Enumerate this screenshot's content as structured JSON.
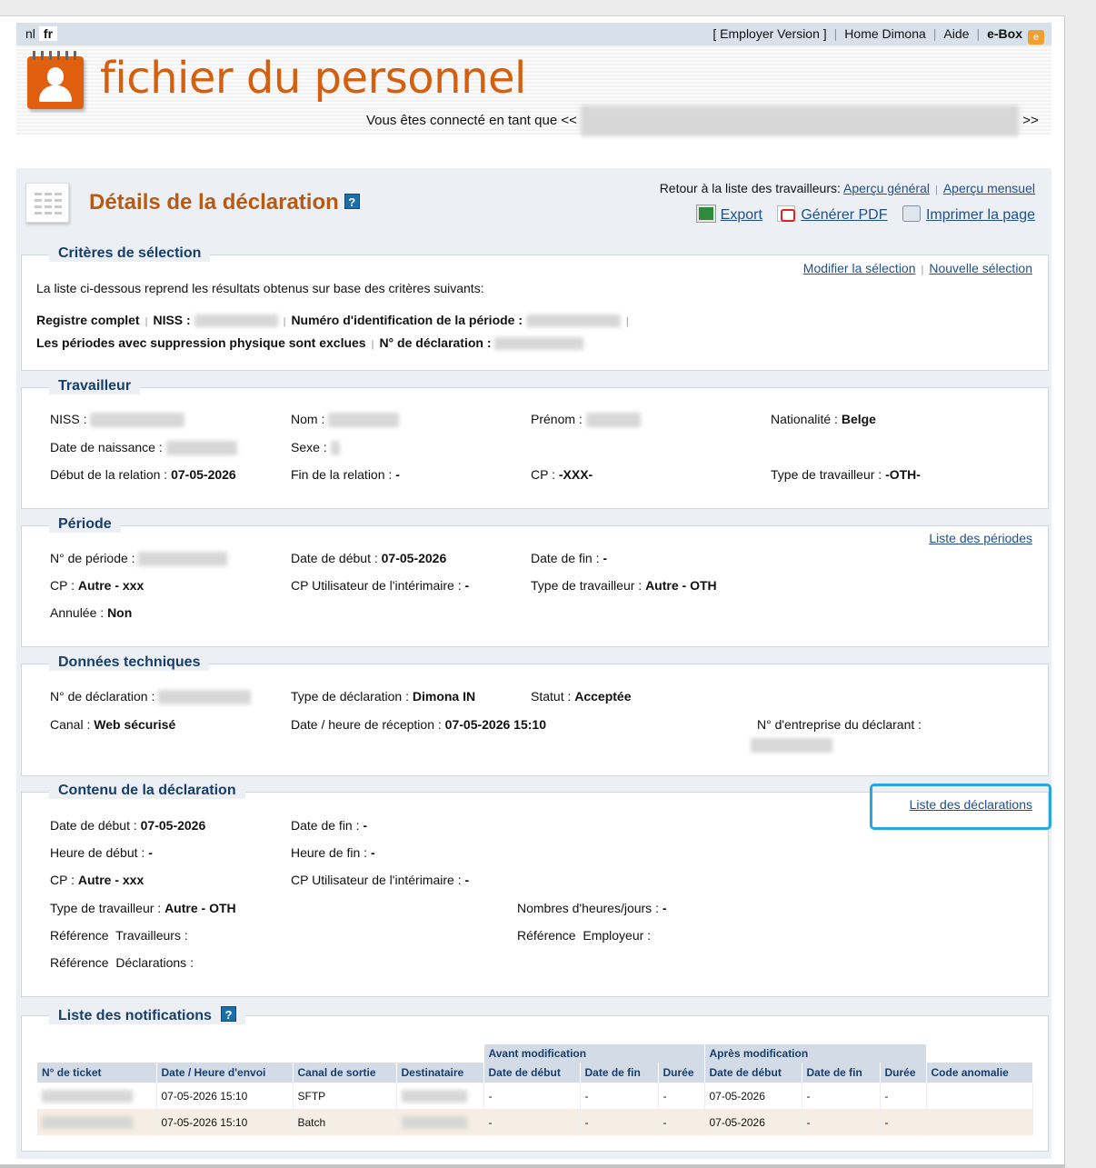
{
  "lang": {
    "nl": "nl",
    "fr": "fr"
  },
  "topnav": {
    "employer_version": "[ Employer Version ]",
    "home": "Home Dimona",
    "aide": "Aide",
    "ebox": "e-Box",
    "ebox_badge": "e"
  },
  "banner": {
    "logo_text": "fichier du personnel",
    "connected_prefix": "Vous êtes connecté en tant que <<",
    "connected_suffix": ">>"
  },
  "header": {
    "title": "Détails de la déclaration",
    "help": "?",
    "back_label": "Retour à la liste des travailleurs:",
    "apercu_general": "Aperçu général",
    "apercu_mensuel": "Aperçu mensuel",
    "export": "Export",
    "pdf": "Générer PDF",
    "print": "Imprimer la page"
  },
  "criteres": {
    "title": "Critères de sélection",
    "modify": "Modifier la sélection",
    "new": "Nouvelle sélection",
    "intro": "La liste ci-dessous reprend les résultats obtenus sur base des critères suivants:",
    "registre": "Registre complet",
    "niss": "NISS :",
    "num_periode": "Numéro d'identification de la période :",
    "exclus": "Les périodes avec suppression physique sont exclues",
    "num_decl": "N° de déclaration :"
  },
  "travailleur": {
    "title": "Travailleur",
    "niss_label": "NISS :",
    "nom_label": "Nom :",
    "prenom_label": "Prénom :",
    "nationalite_label": "Nationalité :",
    "nationalite_value": "Belge",
    "naissance_label": "Date de naissance :",
    "sexe_label": "Sexe :",
    "debut_label": "Début de la relation :",
    "debut_value": "07-05-2026",
    "fin_label": "Fin de la relation :",
    "fin_value": "-",
    "cp_label": "CP :",
    "cp_value": "-XXX-",
    "type_label": "Type de travailleur :",
    "type_value": "-OTH-"
  },
  "periode": {
    "title": "Période",
    "liste_link": "Liste des périodes",
    "num_label": "N° de période :",
    "debut_label": "Date de début :",
    "debut_value": "07-05-2026",
    "fin_label": "Date de fin :",
    "fin_value": "-",
    "cp_label": "CP :",
    "cp_value": "Autre - xxx",
    "cpu_label": "CP Utilisateur de l'intérimaire :",
    "cpu_value": "-",
    "type_label": "Type de travailleur :",
    "type_value": "Autre - OTH",
    "annulee_label": "Annulée :",
    "annulee_value": "Non"
  },
  "technique": {
    "title": "Données techniques",
    "num_label": "N° de déclaration :",
    "type_label": "Type de déclaration :",
    "type_value": "Dimona IN",
    "statut_label": "Statut :",
    "statut_value": "Acceptée",
    "canal_label": "Canal :",
    "canal_value": "Web sécurisé",
    "reception_label": "Date / heure de réception :",
    "reception_value": "07-05-2026 15:10",
    "entreprise_label": "N° d'entreprise du déclarant :"
  },
  "contenu": {
    "title": "Contenu de la déclaration",
    "liste_link": "Liste des déclarations",
    "debut_label": "Date de début :",
    "debut_value": "07-05-2026",
    "fin_label": "Date de fin :",
    "fin_value": "-",
    "hdebut_label": "Heure de début :",
    "hdebut_value": "-",
    "hfin_label": "Heure de fin :",
    "hfin_value": "-",
    "cp_label": "CP :",
    "cp_value": "Autre - xxx",
    "cpu_label": "CP Utilisateur de l'intérimaire :",
    "cpu_value": "-",
    "type_label": "Type de travailleur :",
    "type_value": "Autre - OTH",
    "heures_label": "Nombres d'heures/jours :",
    "heures_value": "-",
    "ref_trav": "Référence  Travailleurs :",
    "ref_empl": "Référence  Employeur :",
    "ref_decl": "Référence  Déclarations :"
  },
  "notifications": {
    "title": "Liste des notifications",
    "help": "?",
    "group_avant": "Avant modification",
    "group_apres": "Après modification",
    "columns": [
      "N° de ticket",
      "Date / Heure d'envoi",
      "Canal de sortie",
      "Destinataire",
      "Date de début",
      "Date de fin",
      "Durée",
      "Date de début",
      "Date de fin",
      "Durée",
      "Code anomalie"
    ],
    "rows": [
      {
        "date": "07-05-2026 15:10",
        "canal": "SFTP",
        "avant_debut": "-",
        "avant_fin": "-",
        "avant_duree": "-",
        "apres_debut": "07-05-2026",
        "apres_fin": "-",
        "apres_duree": "-",
        "code": ""
      },
      {
        "date": "07-05-2026 15:10",
        "canal": "Batch",
        "avant_debut": "-",
        "avant_fin": "-",
        "avant_duree": "-",
        "apres_debut": "07-05-2026",
        "apres_fin": "-",
        "apres_duree": "-",
        "code": ""
      }
    ]
  },
  "colors": {
    "accent": "#b85a14",
    "link": "#1f4f8f",
    "section_title": "#173e6b",
    "highlight": "#29a6e0"
  }
}
